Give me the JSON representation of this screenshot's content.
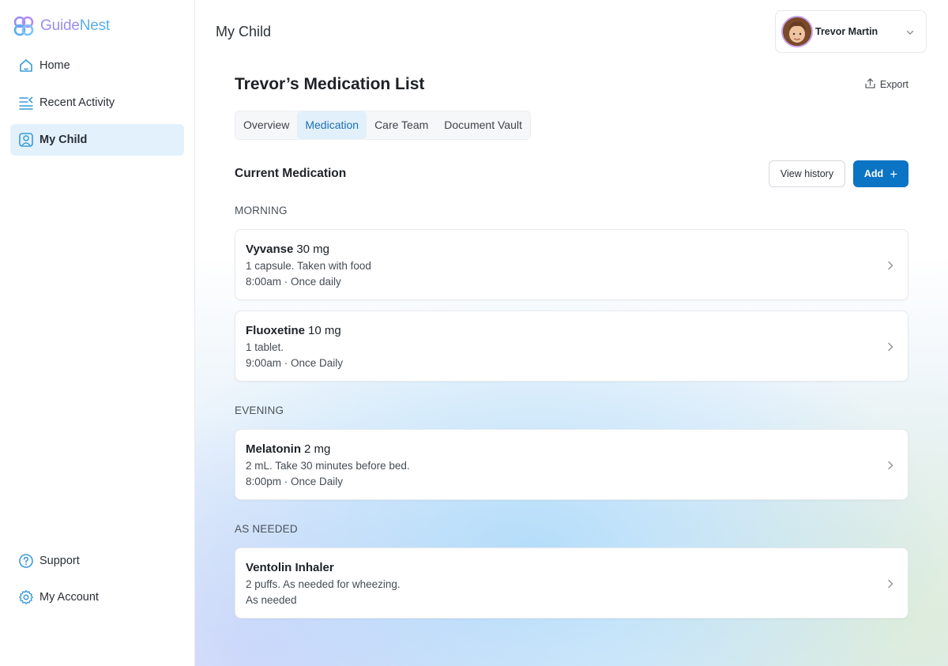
{
  "app": {
    "logo_part1": "Guide",
    "logo_part2": "Nest"
  },
  "sidebar": {
    "items": [
      {
        "label": "Home",
        "icon": "home-icon"
      },
      {
        "label": "Recent Activity",
        "icon": "activity-icon"
      },
      {
        "label": "My Child",
        "icon": "child-profile-icon",
        "active": true
      }
    ],
    "bottom_items": [
      {
        "label": "Support",
        "icon": "help-icon"
      },
      {
        "label": "My Account",
        "icon": "gear-icon"
      }
    ]
  },
  "header": {
    "page_title": "My Child",
    "user_name": "Trevor Martin"
  },
  "main": {
    "title": "Trevor’s Medication List",
    "export_label": "Export",
    "tabs": [
      {
        "label": "Overview"
      },
      {
        "label": "Medication",
        "active": true
      },
      {
        "label": "Care Team"
      },
      {
        "label": "Document Vault"
      }
    ],
    "section_title": "Current Medication",
    "view_history_label": "View history",
    "add_label": "Add",
    "groups": [
      {
        "label": "MORNING",
        "meds": [
          {
            "name": "Vyvanse",
            "dose": "30 mg",
            "instructions": "1 capsule. Taken with food",
            "schedule": "8:00am · Once daily"
          },
          {
            "name": "Fluoxetine",
            "dose": "10 mg",
            "instructions": "1 tablet.",
            "schedule": "9:00am · Once Daily"
          }
        ]
      },
      {
        "label": "EVENING",
        "meds": [
          {
            "name": "Melatonin",
            "dose": "2 mg",
            "instructions": "2 mL. Take 30 minutes before bed.",
            "schedule": "8:00pm · Once Daily"
          }
        ]
      },
      {
        "label": "AS NEEDED",
        "meds": [
          {
            "name": "Ventolin Inhaler",
            "dose": "",
            "instructions": "2 puffs. As needed for wheezing.",
            "schedule": "As needed"
          }
        ]
      }
    ]
  },
  "colors": {
    "accent": "#0b74c4",
    "active_nav_bg": "#e3f1fc",
    "logo_purple": "#9b8ef0",
    "logo_blue": "#5aaef0"
  }
}
